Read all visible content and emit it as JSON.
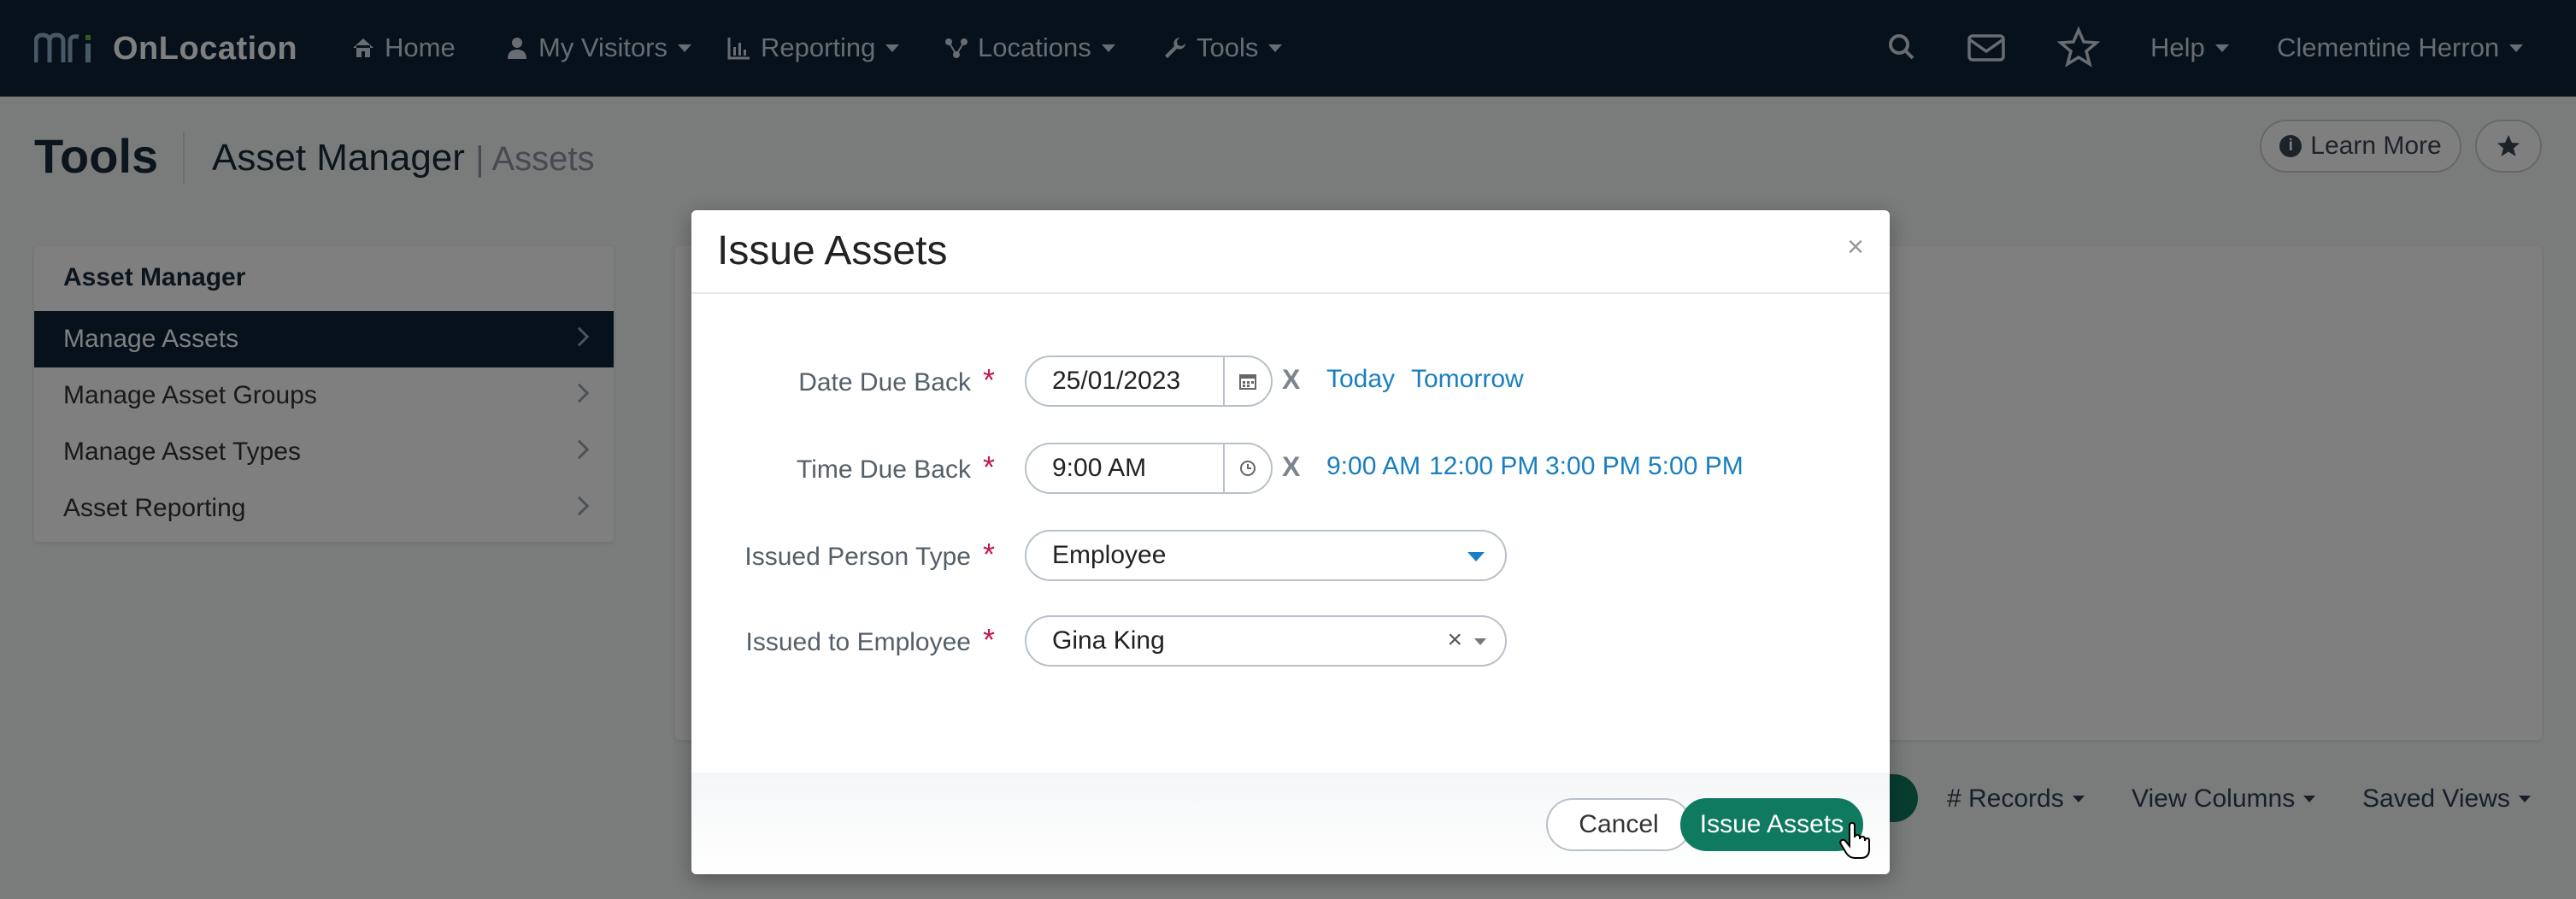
{
  "app": {
    "brand": "OnLocation",
    "colors": {
      "nav_bg": "#0c2238",
      "accent": "#0f7a5f",
      "link": "#1a7fbf",
      "required": "#c4154f"
    }
  },
  "topnav": {
    "items": [
      {
        "label": "Home",
        "icon": "home-icon"
      },
      {
        "label": "My Visitors",
        "icon": "user-icon"
      },
      {
        "label": "Reporting",
        "icon": "bar-chart-icon"
      },
      {
        "label": "Locations",
        "icon": "network-icon"
      },
      {
        "label": "Tools",
        "icon": "wrench-icon"
      }
    ],
    "right": {
      "help_label": "Help",
      "user_name": "Clementine Herron",
      "icons": [
        "search-icon",
        "envelope-icon",
        "star-icon"
      ]
    }
  },
  "header": {
    "title": "Tools",
    "section": "Asset Manager",
    "subsection": "| Assets",
    "learn_more_label": "Learn More"
  },
  "sidebar": {
    "heading": "Asset Manager",
    "items": [
      {
        "label": "Manage Assets",
        "active": true
      },
      {
        "label": "Manage Asset Groups",
        "active": false
      },
      {
        "label": "Manage Asset Types",
        "active": false
      },
      {
        "label": "Asset Reporting",
        "active": false
      }
    ]
  },
  "toolbar": {
    "records_label": "# Records",
    "view_columns_label": "View Columns",
    "saved_views_label": "Saved Views"
  },
  "modal": {
    "title": "Issue Assets",
    "close_glyph": "×",
    "fields": {
      "date_due_back": {
        "label": "Date Due Back",
        "value": "25/01/2023",
        "quick": [
          "Today",
          "Tomorrow"
        ]
      },
      "time_due_back": {
        "label": "Time Due Back",
        "value": "9:00 AM",
        "quick": [
          "9:00 AM",
          "12:00 PM",
          "3:00 PM",
          "5:00 PM"
        ]
      },
      "issued_person_type": {
        "label": "Issued Person Type",
        "value": "Employee"
      },
      "issued_to_employee": {
        "label": "Issued to Employee",
        "value": "Gina King"
      }
    },
    "required_mark": "*",
    "clear_glyph": "X",
    "cancel_label": "Cancel",
    "submit_label": "Issue Assets"
  }
}
